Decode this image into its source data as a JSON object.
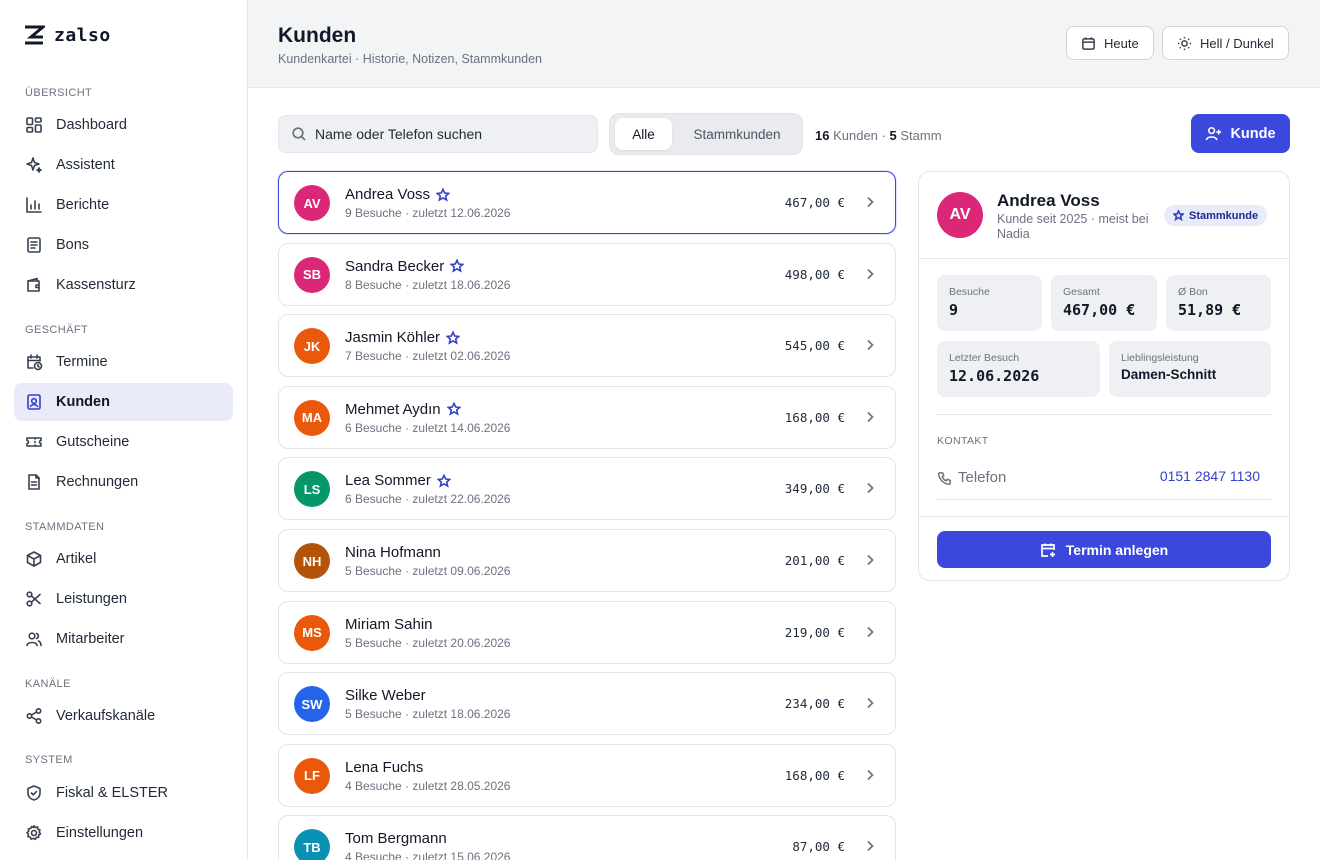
{
  "brand": {
    "name": "zalso"
  },
  "sidebar": {
    "sections": [
      {
        "label": "ÜBERSICHT",
        "items": [
          {
            "label": "Dashboard",
            "icon": "dashboard-icon"
          },
          {
            "label": "Assistent",
            "icon": "sparkle-icon"
          },
          {
            "label": "Berichte",
            "icon": "bar-chart-icon"
          },
          {
            "label": "Bons",
            "icon": "receipt-icon"
          },
          {
            "label": "Kassensturz",
            "icon": "wallet-icon"
          }
        ]
      },
      {
        "label": "GESCHÄFT",
        "items": [
          {
            "label": "Termine",
            "icon": "calendar-clock-icon"
          },
          {
            "label": "Kunden",
            "icon": "contact-icon",
            "active": true
          },
          {
            "label": "Gutscheine",
            "icon": "ticket-icon"
          },
          {
            "label": "Rechnungen",
            "icon": "document-icon"
          }
        ]
      },
      {
        "label": "STAMMDATEN",
        "items": [
          {
            "label": "Artikel",
            "icon": "box-icon"
          },
          {
            "label": "Leistungen",
            "icon": "scissors-icon"
          },
          {
            "label": "Mitarbeiter",
            "icon": "users-icon"
          }
        ]
      },
      {
        "label": "KANÄLE",
        "items": [
          {
            "label": "Verkaufskanäle",
            "icon": "share-icon"
          }
        ]
      },
      {
        "label": "SYSTEM",
        "items": [
          {
            "label": "Fiskal & ELSTER",
            "icon": "shield-icon"
          },
          {
            "label": "Einstellungen",
            "icon": "gear-icon"
          }
        ]
      }
    ]
  },
  "header": {
    "title": "Kunden",
    "subtitle": "Kundenkartei · Historie, Notizen, Stammkunden",
    "today_label": "Heute",
    "theme_label": "Hell / Dunkel"
  },
  "toolbar": {
    "search_placeholder": "Name oder Telefon suchen",
    "filter_all": "Alle",
    "filter_regulars": "Stammkunden",
    "count_total": "16",
    "count_total_label": "Kunden",
    "count_sep": "·",
    "count_regulars": "5",
    "count_regulars_label": "Stamm",
    "add_label": "Kunde"
  },
  "customers": [
    {
      "initials": "AV",
      "name": "Andrea Voss",
      "star": true,
      "visits": "9 Besuche",
      "last_label": "· zuletzt",
      "last_date": "12.06.2026",
      "amount": "467,00 €",
      "color": "#db2777"
    },
    {
      "initials": "SB",
      "name": "Sandra Becker",
      "star": true,
      "visits": "8 Besuche",
      "last_label": "· zuletzt",
      "last_date": "18.06.2026",
      "amount": "498,00 €",
      "color": "#db2777"
    },
    {
      "initials": "JK",
      "name": "Jasmin Köhler",
      "star": true,
      "visits": "7 Besuche",
      "last_label": "· zuletzt",
      "last_date": "02.06.2026",
      "amount": "545,00 €",
      "color": "#ea580c"
    },
    {
      "initials": "MA",
      "name": "Mehmet Aydın",
      "star": true,
      "visits": "6 Besuche",
      "last_label": "· zuletzt",
      "last_date": "14.06.2026",
      "amount": "168,00 €",
      "color": "#ea580c"
    },
    {
      "initials": "LS",
      "name": "Lea Sommer",
      "star": true,
      "visits": "6 Besuche",
      "last_label": "· zuletzt",
      "last_date": "22.06.2026",
      "amount": "349,00 €",
      "color": "#059669"
    },
    {
      "initials": "NH",
      "name": "Nina Hofmann",
      "star": false,
      "visits": "5 Besuche",
      "last_label": "· zuletzt",
      "last_date": "09.06.2026",
      "amount": "201,00 €",
      "color": "#b45309"
    },
    {
      "initials": "MS",
      "name": "Miriam Sahin",
      "star": false,
      "visits": "5 Besuche",
      "last_label": "· zuletzt",
      "last_date": "20.06.2026",
      "amount": "219,00 €",
      "color": "#ea580c"
    },
    {
      "initials": "SW",
      "name": "Silke Weber",
      "star": false,
      "visits": "5 Besuche",
      "last_label": "· zuletzt",
      "last_date": "18.06.2026",
      "amount": "234,00 €",
      "color": "#2563eb"
    },
    {
      "initials": "LF",
      "name": "Lena Fuchs",
      "star": false,
      "visits": "4 Besuche",
      "last_label": "· zuletzt",
      "last_date": "28.05.2026",
      "amount": "168,00 €",
      "color": "#ea580c"
    },
    {
      "initials": "TB",
      "name": "Tom Bergmann",
      "star": false,
      "visits": "4 Besuche",
      "last_label": "· zuletzt",
      "last_date": "15.06.2026",
      "amount": "87,00 €",
      "color": "#0891b2"
    }
  ],
  "detail": {
    "initials": "AV",
    "name": "Andrea Voss",
    "since": "Kunde seit 2025 · meist bei Nadia",
    "badge": "Stammkunde",
    "stats": {
      "visits_label": "Besuche",
      "visits": "9",
      "total_label": "Gesamt",
      "total": "467,00 €",
      "avg_label": "Ø Bon",
      "avg": "51,89 €",
      "last_label": "Letzter Besuch",
      "last": "12.06.2026",
      "fav_label": "Lieblingsleistung",
      "fav": "Damen-Schnitt"
    },
    "contact_label": "KONTAKT",
    "phone_label": "Telefon",
    "phone": "0151 2847 1130",
    "cta": "Termin anlegen"
  }
}
